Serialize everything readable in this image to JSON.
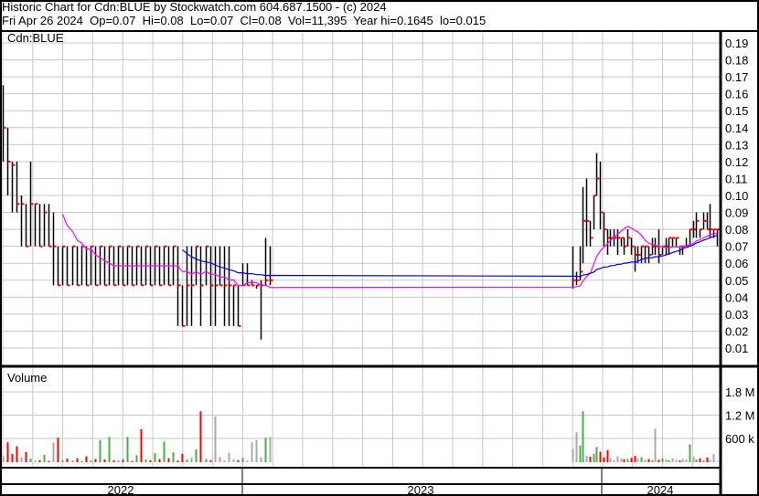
{
  "header": {
    "title": "Historic Chart for Cdn:BLUE by Stockwatch.com 604.687.1500 - (c) 2024",
    "quote": "Fri Apr 26 2024  Op=0.07  Hi=0.08  Lo=0.07  Cl=0.08  Vol=11,395  Year hi=0.1645  lo=0.015"
  },
  "colors": {
    "up": "#44b044",
    "down": "#ff0000",
    "flat": "#aaaaaa",
    "ma_short": "#ff00ff",
    "ma_long": "#0000ff",
    "grid": "#c8c8c8"
  },
  "chart_data": {
    "type": "bar",
    "symbol_label": "Cdn:BLUE",
    "volume_label": "Volume",
    "price_axis": {
      "ylim": [
        0,
        0.19
      ],
      "ticks": [
        "0.01",
        "0.02",
        "0.03",
        "0.04",
        "0.05",
        "0.06",
        "0.07",
        "0.08",
        "0.09",
        "0.10",
        "0.11",
        "0.12",
        "0.13",
        "0.14",
        "0.15",
        "0.16",
        "0.17",
        "0.18",
        "0.19"
      ]
    },
    "volume_axis": {
      "ylim": [
        0,
        2200000
      ],
      "ticks": [
        {
          "v": 600000,
          "label": "600 k"
        },
        {
          "v": 1200000,
          "label": "1.2 M"
        },
        {
          "v": 1800000,
          "label": "1.8 M"
        }
      ]
    },
    "years": [
      "2022",
      "2023",
      "2024"
    ],
    "moving_averages": [
      14,
      40
    ],
    "segments": [
      {
        "name": "2022",
        "bars_hi_lo_close_vol": [
          [
            0.165,
            0.12,
            0.14,
            150000
          ],
          [
            0.14,
            0.1,
            0.12,
            500000
          ],
          [
            0.12,
            0.09,
            0.118,
            200000
          ],
          [
            0.12,
            0.09,
            0.095,
            400000
          ],
          [
            0.1,
            0.07,
            0.095,
            120000
          ],
          [
            0.095,
            0.07,
            0.07,
            250000
          ],
          [
            0.12,
            0.07,
            0.095,
            80000
          ],
          [
            0.095,
            0.07,
            0.095,
            30000
          ],
          [
            0.095,
            0.07,
            0.07,
            40000
          ],
          [
            0.095,
            0.07,
            0.09,
            180000
          ],
          [
            0.095,
            0.07,
            0.07,
            20000
          ],
          [
            0.09,
            0.047,
            0.07,
            500000
          ],
          [
            0.07,
            0.047,
            0.047,
            620000
          ],
          [
            0.07,
            0.047,
            0.07,
            40000
          ],
          [
            0.07,
            0.047,
            0.047,
            80000
          ],
          [
            0.07,
            0.047,
            0.07,
            30000
          ],
          [
            0.07,
            0.047,
            0.047,
            90000
          ],
          [
            0.07,
            0.047,
            0.07,
            20000
          ],
          [
            0.07,
            0.047,
            0.047,
            140000
          ],
          [
            0.07,
            0.047,
            0.07,
            30000
          ],
          [
            0.07,
            0.047,
            0.047,
            70000
          ],
          [
            0.07,
            0.047,
            0.07,
            560000
          ],
          [
            0.07,
            0.047,
            0.047,
            60000
          ],
          [
            0.07,
            0.047,
            0.07,
            640000
          ],
          [
            0.07,
            0.047,
            0.047,
            40000
          ],
          [
            0.07,
            0.047,
            0.07,
            30000
          ],
          [
            0.07,
            0.047,
            0.047,
            60000
          ],
          [
            0.07,
            0.047,
            0.07,
            640000
          ],
          [
            0.07,
            0.047,
            0.047,
            20000
          ],
          [
            0.07,
            0.047,
            0.07,
            170000
          ],
          [
            0.07,
            0.047,
            0.047,
            840000
          ],
          [
            0.07,
            0.047,
            0.07,
            60000
          ],
          [
            0.07,
            0.047,
            0.047,
            40000
          ],
          [
            0.07,
            0.047,
            0.07,
            220000
          ],
          [
            0.07,
            0.047,
            0.047,
            70000
          ],
          [
            0.07,
            0.047,
            0.07,
            520000
          ],
          [
            0.07,
            0.047,
            0.047,
            90000
          ],
          [
            0.07,
            0.047,
            0.07,
            240000
          ],
          [
            0.07,
            0.023,
            0.047,
            30000
          ],
          [
            0.047,
            0.023,
            0.023,
            200000
          ],
          [
            0.07,
            0.023,
            0.047,
            60000
          ],
          [
            0.07,
            0.023,
            0.047,
            110000
          ],
          [
            0.07,
            0.047,
            0.07,
            320000
          ],
          [
            0.07,
            0.023,
            0.047,
            1300000
          ],
          [
            0.07,
            0.047,
            0.07,
            70000
          ],
          [
            0.07,
            0.023,
            0.047,
            40000
          ],
          [
            0.07,
            0.023,
            0.047,
            1170000
          ],
          [
            0.07,
            0.047,
            0.047,
            120000
          ],
          [
            0.07,
            0.023,
            0.047,
            30000
          ],
          [
            0.07,
            0.023,
            0.047,
            230000
          ],
          [
            0.047,
            0.023,
            0.047,
            60000
          ],
          [
            0.047,
            0.023,
            0.023,
            40000
          ],
          [
            0.06,
            0.047,
            0.047,
            100000
          ],
          [
            0.06,
            0.047,
            0.047,
            30000
          ],
          [
            0.05,
            0.047,
            0.047,
            500000
          ],
          [
            0.047,
            0.045,
            0.047,
            560000
          ],
          [
            0.05,
            0.015,
            0.047,
            120000
          ],
          [
            0.075,
            0.047,
            0.05,
            620000
          ],
          [
            0.07,
            0.047,
            0.05,
            640000
          ]
        ]
      },
      {
        "name": "2023-2024",
        "bars_hi_lo_close_vol": [
          [
            0.07,
            0.045,
            0.05,
            340000
          ],
          [
            0.055,
            0.047,
            0.05,
            760000
          ],
          [
            0.07,
            0.05,
            0.055,
            420000
          ],
          [
            0.105,
            0.06,
            0.085,
            1300000
          ],
          [
            0.11,
            0.07,
            0.085,
            160000
          ],
          [
            0.085,
            0.07,
            0.075,
            130000
          ],
          [
            0.1,
            0.08,
            0.1,
            200000
          ],
          [
            0.125,
            0.1,
            0.11,
            380000
          ],
          [
            0.12,
            0.08,
            0.09,
            260000
          ],
          [
            0.09,
            0.07,
            0.08,
            110000
          ],
          [
            0.08,
            0.065,
            0.075,
            300000
          ],
          [
            0.08,
            0.07,
            0.075,
            90000
          ],
          [
            0.08,
            0.07,
            0.075,
            40000
          ],
          [
            0.08,
            0.065,
            0.075,
            140000
          ],
          [
            0.075,
            0.07,
            0.075,
            90000
          ],
          [
            0.075,
            0.065,
            0.07,
            60000
          ],
          [
            0.08,
            0.07,
            0.075,
            70000
          ],
          [
            0.075,
            0.065,
            0.07,
            100000
          ],
          [
            0.07,
            0.055,
            0.065,
            150000
          ],
          [
            0.07,
            0.06,
            0.065,
            80000
          ],
          [
            0.07,
            0.06,
            0.07,
            120000
          ],
          [
            0.07,
            0.06,
            0.07,
            60000
          ],
          [
            0.07,
            0.06,
            0.065,
            70000
          ],
          [
            0.075,
            0.065,
            0.07,
            40000
          ],
          [
            0.075,
            0.065,
            0.07,
            860000
          ],
          [
            0.08,
            0.06,
            0.065,
            50000
          ],
          [
            0.07,
            0.065,
            0.07,
            90000
          ],
          [
            0.075,
            0.065,
            0.07,
            60000
          ],
          [
            0.075,
            0.065,
            0.075,
            40000
          ],
          [
            0.075,
            0.07,
            0.075,
            90000
          ],
          [
            0.075,
            0.07,
            0.075,
            50000
          ],
          [
            0.07,
            0.065,
            0.07,
            30000
          ],
          [
            0.07,
            0.065,
            0.07,
            70000
          ],
          [
            0.075,
            0.07,
            0.07,
            60000
          ],
          [
            0.08,
            0.07,
            0.08,
            450000
          ],
          [
            0.085,
            0.075,
            0.08,
            130000
          ],
          [
            0.09,
            0.075,
            0.085,
            60000
          ],
          [
            0.08,
            0.075,
            0.08,
            90000
          ],
          [
            0.09,
            0.08,
            0.085,
            40000
          ],
          [
            0.09,
            0.08,
            0.08,
            110000
          ],
          [
            0.095,
            0.075,
            0.08,
            50000
          ],
          [
            0.08,
            0.075,
            0.08,
            200000
          ],
          [
            0.08,
            0.07,
            0.08,
            11395
          ]
        ]
      }
    ]
  }
}
